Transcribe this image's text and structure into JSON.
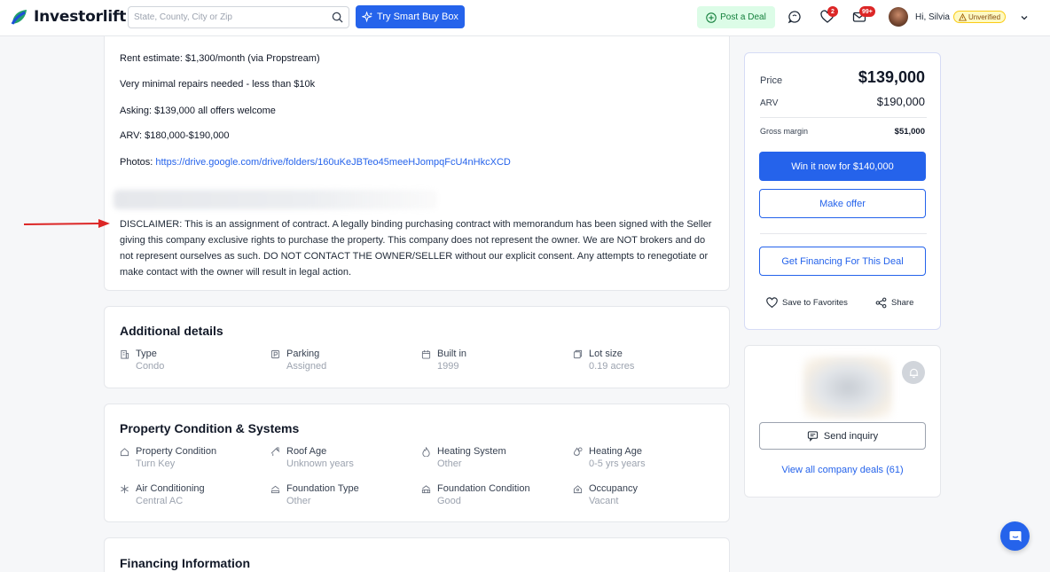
{
  "header": {
    "logo_text": "Investorlift",
    "search_placeholder": "State, County, City or Zip",
    "smart_buy_label": "Try Smart Buy Box",
    "post_deal_label": "Post a Deal",
    "favorites_badge": "2",
    "messages_badge": "99+",
    "greeting": "Hi, Silvia",
    "verification_status": "Unverified",
    "colors": {
      "brand_blue": "#2563eb",
      "post_green": "#15803d",
      "badge_red": "#dc2626"
    }
  },
  "description": {
    "rent_estimate": "Rent estimate: $1,300/month (via Propstream)",
    "repairs": "Very minimal repairs needed - less than $10k",
    "asking": "Asking: $139,000 all offers welcome",
    "arv": "ARV: $180,000-$190,000",
    "photos_label": "Photos: ",
    "photos_link": "https://drive.google.com/drive/folders/160uKeJBTeo45meeHJompqFcU4nHkcXCD",
    "disclaimer": "DISCLAIMER: This is an assignment of contract. A legally binding purchasing contract with memorandum has been signed with the Seller giving this company exclusive rights to purchase the property. This company does not represent the owner. We are NOT brokers and do not represent ourselves as such. DO NOT CONTACT THE OWNER/SELLER without our explicit consent. Any attempts to renegotiate or make contact with the owner will result in legal action."
  },
  "additional_details": {
    "title": "Additional details",
    "items": [
      {
        "label": "Type",
        "value": "Condo",
        "icon": "building-icon"
      },
      {
        "label": "Parking",
        "value": "Assigned",
        "icon": "parking-icon"
      },
      {
        "label": "Built in",
        "value": "1999",
        "icon": "calendar-icon"
      },
      {
        "label": "Lot size",
        "value": "0.19 acres",
        "icon": "lot-icon"
      }
    ]
  },
  "property_condition": {
    "title": "Property Condition & Systems",
    "items": [
      {
        "label": "Property Condition",
        "value": "Turn Key",
        "icon": "home-icon"
      },
      {
        "label": "Roof Age",
        "value": "Unknown years",
        "icon": "roof-icon"
      },
      {
        "label": "Heating System",
        "value": "Other",
        "icon": "flame-icon"
      },
      {
        "label": "Heating Age",
        "value": "0-5 yrs years",
        "icon": "flame-clock-icon"
      },
      {
        "label": "Air Conditioning",
        "value": "Central AC",
        "icon": "snowflake-icon"
      },
      {
        "label": "Foundation Type",
        "value": "Other",
        "icon": "foundation-icon"
      },
      {
        "label": "Foundation Condition",
        "value": "Good",
        "icon": "foundation-check-icon"
      },
      {
        "label": "Occupancy",
        "value": "Vacant",
        "icon": "house-person-icon"
      }
    ]
  },
  "financing": {
    "title": "Financing Information"
  },
  "price_panel": {
    "price_label": "Price",
    "price_value": "$139,000",
    "arv_label": "ARV",
    "arv_value": "$190,000",
    "margin_label": "Gross margin",
    "margin_value": "$51,000",
    "win_button": "Win it now for $140,000",
    "offer_button": "Make offer",
    "financing_button": "Get Financing For This Deal",
    "save_label": "Save to Favorites",
    "share_label": "Share"
  },
  "company_panel": {
    "send_inquiry": "Send inquiry",
    "view_all": "View all company deals (61)"
  }
}
